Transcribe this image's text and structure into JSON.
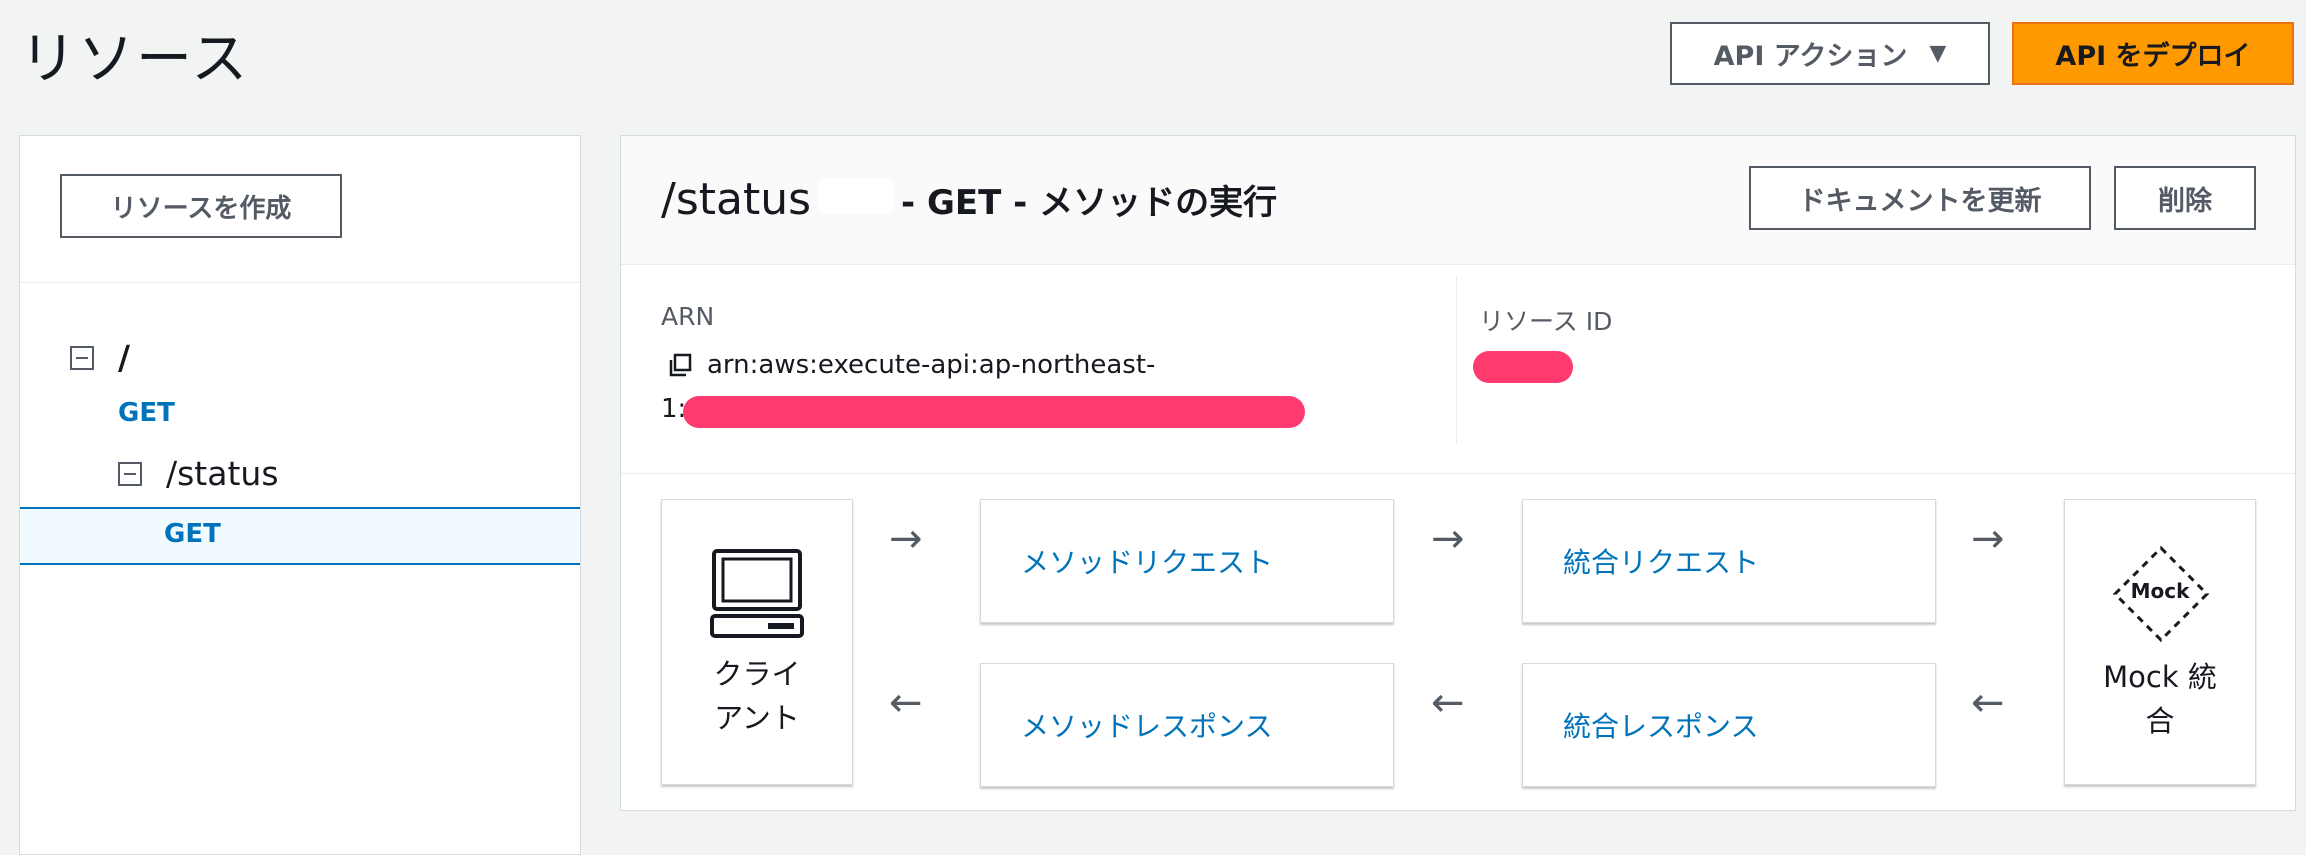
{
  "header": {
    "title": "リソース",
    "actions_label": "API アクション",
    "actions_caret": "▼",
    "deploy_label": "API をデプロイ"
  },
  "sidebar": {
    "create_label": "リソースを作成",
    "tree": [
      {
        "path": "/",
        "method": "GET"
      },
      {
        "path": "/status",
        "method": "GET",
        "selected": true
      }
    ]
  },
  "method_panel": {
    "title_path": "/status",
    "title_suffix": "- GET - メソッドの実行",
    "docs_label": "ドキュメントを更新",
    "delete_label": "削除",
    "arn_label": "ARN",
    "arn_value_line1": "arn:aws:execute-api:ap-northeast-",
    "arn_value_line2": "1:",
    "resource_id_label": "リソース ID",
    "redaction_color": "#ff3a6e"
  },
  "flow": {
    "client_line1": "クライ",
    "client_line2": "アント",
    "method_request": "メソッドリクエスト",
    "integration_request": "統合リクエスト",
    "method_response": "メソッドレスポンス",
    "integration_response": "統合レスポンス",
    "mock_badge": "Mock",
    "mock_line1": "Mock 統",
    "mock_line2": "合",
    "arrow_right": "→",
    "arrow_left": "←"
  },
  "colors": {
    "accent": "#0073bb",
    "deploy_button": "#ff9900",
    "background": "#f2f3f3"
  }
}
